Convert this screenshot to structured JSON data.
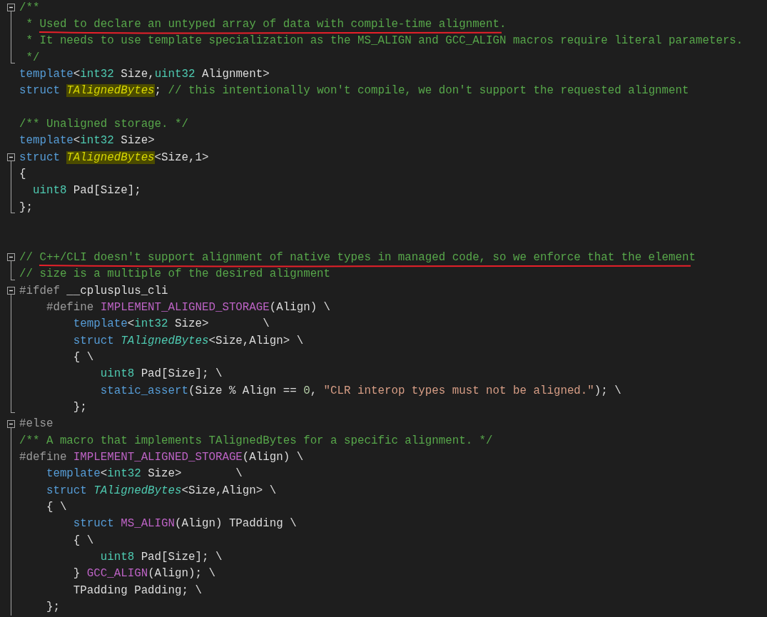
{
  "editor": {
    "lines": [
      {
        "kind": "collapse",
        "tokens": [
          {
            "t": "/**",
            "kind": "cm"
          }
        ]
      },
      {
        "kind": "continue",
        "annotated": true,
        "tokens": [
          {
            "t": " * Used to declare an untyped array of data with compile-time alignment.",
            "kind": "cm"
          }
        ]
      },
      {
        "kind": "continue",
        "tokens": [
          {
            "t": " * It needs to use template specialization as the MS_ALIGN and GCC_ALIGN macros require literal parameters.",
            "kind": "cm"
          }
        ]
      },
      {
        "kind": "end",
        "tokens": [
          {
            "t": " */",
            "kind": "cm"
          }
        ]
      },
      {
        "kind": "plain",
        "tokens": [
          {
            "t": "template",
            "kind": "kw"
          },
          {
            "t": "<",
            "kind": "plain"
          },
          {
            "t": "int32",
            "kind": "type"
          },
          {
            "t": " Size,",
            "kind": "plain"
          },
          {
            "t": "uint32",
            "kind": "type"
          },
          {
            "t": " Alignment>",
            "kind": "plain"
          }
        ]
      },
      {
        "kind": "plain",
        "tokens": [
          {
            "t": "struct ",
            "kind": "kw"
          },
          {
            "t": "TAlignedBytes",
            "kind": "cls",
            "highlighted": true
          },
          {
            "t": "; ",
            "kind": "plain"
          },
          {
            "t": "// this intentionally won't compile, we don't support the requested alignment",
            "kind": "cm"
          }
        ]
      },
      {
        "kind": "blank"
      },
      {
        "kind": "plain",
        "tokens": [
          {
            "t": "/** Unaligned storage. */",
            "kind": "cm"
          }
        ]
      },
      {
        "kind": "plain",
        "tokens": [
          {
            "t": "template",
            "kind": "kw"
          },
          {
            "t": "<",
            "kind": "plain"
          },
          {
            "t": "int32",
            "kind": "type"
          },
          {
            "t": " Size>",
            "kind": "plain"
          }
        ]
      },
      {
        "kind": "collapse",
        "tokens": [
          {
            "t": "struct ",
            "kind": "kw"
          },
          {
            "t": "TAlignedBytes",
            "kind": "cls",
            "highlighted": true
          },
          {
            "t": "<Size,1>",
            "kind": "plain"
          }
        ]
      },
      {
        "kind": "continue",
        "tokens": [
          {
            "t": "{",
            "kind": "plain"
          }
        ]
      },
      {
        "kind": "continue",
        "tokens": [
          {
            "t": "  uint8",
            "kind": "type"
          },
          {
            "t": " Pad[Size];",
            "kind": "plain"
          }
        ]
      },
      {
        "kind": "end",
        "tokens": [
          {
            "t": "};",
            "kind": "plain"
          }
        ]
      },
      {
        "kind": "blank"
      },
      {
        "kind": "blank"
      },
      {
        "kind": "collapse",
        "annotated": true,
        "tokens": [
          {
            "t": "// C++/CLI doesn't support alignment of native types in managed code, so we enforce that the element",
            "kind": "cm"
          }
        ]
      },
      {
        "kind": "end",
        "tokens": [
          {
            "t": "// size is a multiple of the desired alignment",
            "kind": "cm"
          }
        ]
      },
      {
        "kind": "collapse",
        "tokens": [
          {
            "t": "#ifdef ",
            "kind": "pp"
          },
          {
            "t": "__cplusplus_cli",
            "kind": "plain"
          }
        ]
      },
      {
        "kind": "continue",
        "tokens": [
          {
            "t": "    #define ",
            "kind": "pp"
          },
          {
            "t": "IMPLEMENT_ALIGNED_STORAGE",
            "kind": "macro"
          },
          {
            "t": "(Align) \\",
            "kind": "plain"
          }
        ]
      },
      {
        "kind": "continue",
        "tokens": [
          {
            "t": "        template",
            "kind": "kw"
          },
          {
            "t": "<",
            "kind": "plain"
          },
          {
            "t": "int32",
            "kind": "type"
          },
          {
            "t": " Size>        \\",
            "kind": "plain"
          }
        ]
      },
      {
        "kind": "continue",
        "tokens": [
          {
            "t": "        struct ",
            "kind": "kw"
          },
          {
            "t": "TAlignedBytes",
            "kind": "cls",
            "highlighted": false
          },
          {
            "t": "<Size,Align> \\",
            "kind": "plain"
          }
        ]
      },
      {
        "kind": "continue",
        "tokens": [
          {
            "t": "        { \\",
            "kind": "plain"
          }
        ]
      },
      {
        "kind": "continue",
        "tokens": [
          {
            "t": "            uint8",
            "kind": "type"
          },
          {
            "t": " Pad[Size]; \\",
            "kind": "plain"
          }
        ]
      },
      {
        "kind": "continue",
        "tokens": [
          {
            "t": "            static_assert",
            "kind": "kw"
          },
          {
            "t": "(Size % Align == ",
            "kind": "plain"
          },
          {
            "t": "0",
            "kind": "num"
          },
          {
            "t": ", ",
            "kind": "plain"
          },
          {
            "t": "\"CLR interop types must not be aligned.\"",
            "kind": "str"
          },
          {
            "t": "); \\",
            "kind": "plain"
          }
        ]
      },
      {
        "kind": "end",
        "tokens": [
          {
            "t": "        };",
            "kind": "plain"
          }
        ]
      },
      {
        "kind": "collapse",
        "tokens": [
          {
            "t": "#else",
            "kind": "pp"
          }
        ]
      },
      {
        "kind": "continue",
        "tokens": [
          {
            "t": "/** A macro that implements TAlignedBytes for a specific alignment. */",
            "kind": "cm"
          }
        ]
      },
      {
        "kind": "continue",
        "tokens": [
          {
            "t": "#define ",
            "kind": "pp"
          },
          {
            "t": "IMPLEMENT_ALIGNED_STORAGE",
            "kind": "macro"
          },
          {
            "t": "(Align) \\",
            "kind": "plain"
          }
        ]
      },
      {
        "kind": "continue",
        "tokens": [
          {
            "t": "    template",
            "kind": "kw"
          },
          {
            "t": "<",
            "kind": "plain"
          },
          {
            "t": "int32",
            "kind": "type"
          },
          {
            "t": " Size>        \\",
            "kind": "plain"
          }
        ]
      },
      {
        "kind": "continue",
        "tokens": [
          {
            "t": "    struct ",
            "kind": "kw"
          },
          {
            "t": "TAlignedBytes",
            "kind": "cls",
            "highlighted": false
          },
          {
            "t": "<Size,Align> \\",
            "kind": "plain"
          }
        ]
      },
      {
        "kind": "continue",
        "tokens": [
          {
            "t": "    { \\",
            "kind": "plain"
          }
        ]
      },
      {
        "kind": "continue",
        "tokens": [
          {
            "t": "        struct ",
            "kind": "kw"
          },
          {
            "t": "MS_ALIGN",
            "kind": "macro"
          },
          {
            "t": "(Align) TPadding \\",
            "kind": "plain"
          }
        ]
      },
      {
        "kind": "continue",
        "tokens": [
          {
            "t": "        { \\",
            "kind": "plain"
          }
        ]
      },
      {
        "kind": "continue",
        "tokens": [
          {
            "t": "            uint8",
            "kind": "type"
          },
          {
            "t": " Pad[Size]; \\",
            "kind": "plain"
          }
        ]
      },
      {
        "kind": "continue",
        "tokens": [
          {
            "t": "        } ",
            "kind": "plain"
          },
          {
            "t": "GCC_ALIGN",
            "kind": "macro"
          },
          {
            "t": "(Align); \\",
            "kind": "plain"
          }
        ]
      },
      {
        "kind": "continue",
        "tokens": [
          {
            "t": "        TPadding Padding; \\",
            "kind": "plain"
          }
        ]
      },
      {
        "kind": "continue",
        "tokens": [
          {
            "t": "    };",
            "kind": "plain"
          }
        ]
      }
    ]
  }
}
